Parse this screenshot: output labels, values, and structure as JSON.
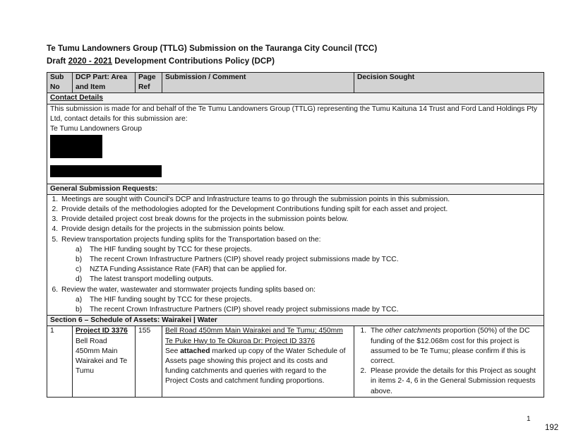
{
  "title": {
    "line1": "Te Tumu Landowners Group (TTLG) Submission on the Tauranga City Council (TCC)",
    "line2_prefix": "Draft ",
    "line2_years": "2020 - 2021",
    "line2_suffix": " Development Contributions Policy (DCP)"
  },
  "table": {
    "headers": {
      "sub_no": "Sub No",
      "dcp_part": "DCP Part: Area and Item",
      "page_ref": "Page Ref",
      "submission": "Submission / Comment",
      "decision": "Decision Sought"
    },
    "contact": {
      "heading": "Contact Details",
      "text": "This submission is made for and behalf of the Te Tumu Landowners Group (TTLG) representing the Tumu Kaituna 14 Trust and Ford Land Holdings Pty Ltd, contact details for this submission are:",
      "group": "Te Tumu Landowners Group"
    },
    "general": {
      "heading": "General Submission Requests:",
      "items": [
        "Meetings are sought with Council's DCP and Infrastructure teams to go through the submission points in this submission.",
        "Provide details of the methodologies adopted for the Development Contributions funding spilt for each asset and project.",
        "Provide detailed project cost break downs for the projects in the submission points below.",
        "Provide design details for the projects in the submission points below.",
        "Review transportation projects funding splits for the Transportation based on the:",
        "Review the water, wastewater and stormwater projects funding splits based on:"
      ],
      "sub5": [
        "The HIF funding sought by TCC for these projects.",
        "The recent Crown Infrastructure Partners (CIP) shovel ready project submissions made by TCC.",
        "NZTA Funding Assistance Rate (FAR) that can be applied for.",
        "The latest transport modelling outputs."
      ],
      "sub6": [
        "The HIF funding sought by TCC for these projects.",
        "The recent Crown Infrastructure Partners (CIP) shovel ready project submissions made by TCC."
      ]
    },
    "section6": {
      "heading": "Section 6 – Schedule of Assets: Wairakei | Water"
    },
    "row1": {
      "sub_no": "1",
      "project_id": "Project ID 3376",
      "area_item": "Bell Road 450mm Main Wairakei and Te Tumu",
      "page_ref": "155",
      "sub_title": "Bell Road 450mm Main Wairakei and Te Tumu; 450mm Te Puke Hwy to Te Okuroa Dr: Project ID 3376",
      "sub_pre": "See ",
      "sub_bold": "attached",
      "sub_post": " marked up copy of the Water Schedule of Assets page showing this project and its costs and funding catchments and queries with regard to the Project Costs and catchment funding proportions.",
      "d1_pre": "The ",
      "d1_italic": "other catchments",
      "d1_post": " proportion (50%) of the DC funding of the $12.068m cost for this project is assumed to be Te Tumu; please confirm if this is correct.",
      "d2": "Please provide the details for this Project as sought in items 2- 4, 6 in the General Submission requests above."
    }
  },
  "footer": {
    "page_number": "1",
    "agenda_page": "192"
  }
}
